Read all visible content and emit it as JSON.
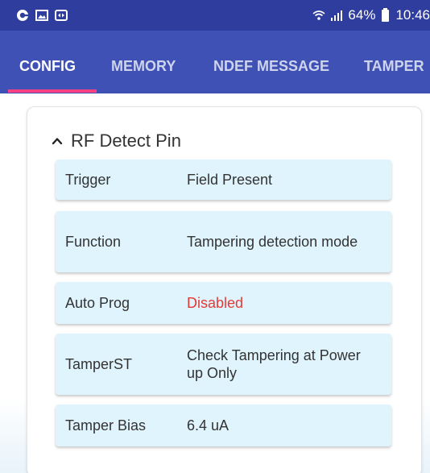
{
  "status_bar": {
    "icons": [
      "sync-icon",
      "image-icon",
      "screen-mirror-icon"
    ],
    "signal": "ⓘ",
    "battery": "64%",
    "time": "10:46"
  },
  "tabs": [
    {
      "label": "CONFIG",
      "active": true
    },
    {
      "label": "MEMORY",
      "active": false
    },
    {
      "label": "NDEF MESSAGE",
      "active": false
    },
    {
      "label": "TAMPER",
      "active": false
    }
  ],
  "section": {
    "title": "RF Detect Pin",
    "rows": [
      {
        "label": "Trigger",
        "value": "Field Present"
      },
      {
        "label": "Function",
        "value": "Tampering detection mode"
      },
      {
        "label": "Auto Prog",
        "value": "Disabled"
      },
      {
        "label": "TamperST",
        "value": "Check Tampering at Power up Only"
      },
      {
        "label": "Tamper Bias",
        "value": "6.4 uA"
      }
    ]
  },
  "colors": {
    "status_bar": "#2f3e9e",
    "app_bar": "#3f51b5",
    "indicator": "#ff4081",
    "row_bg": "#e0f4fd",
    "disabled_text": "#e53935"
  }
}
